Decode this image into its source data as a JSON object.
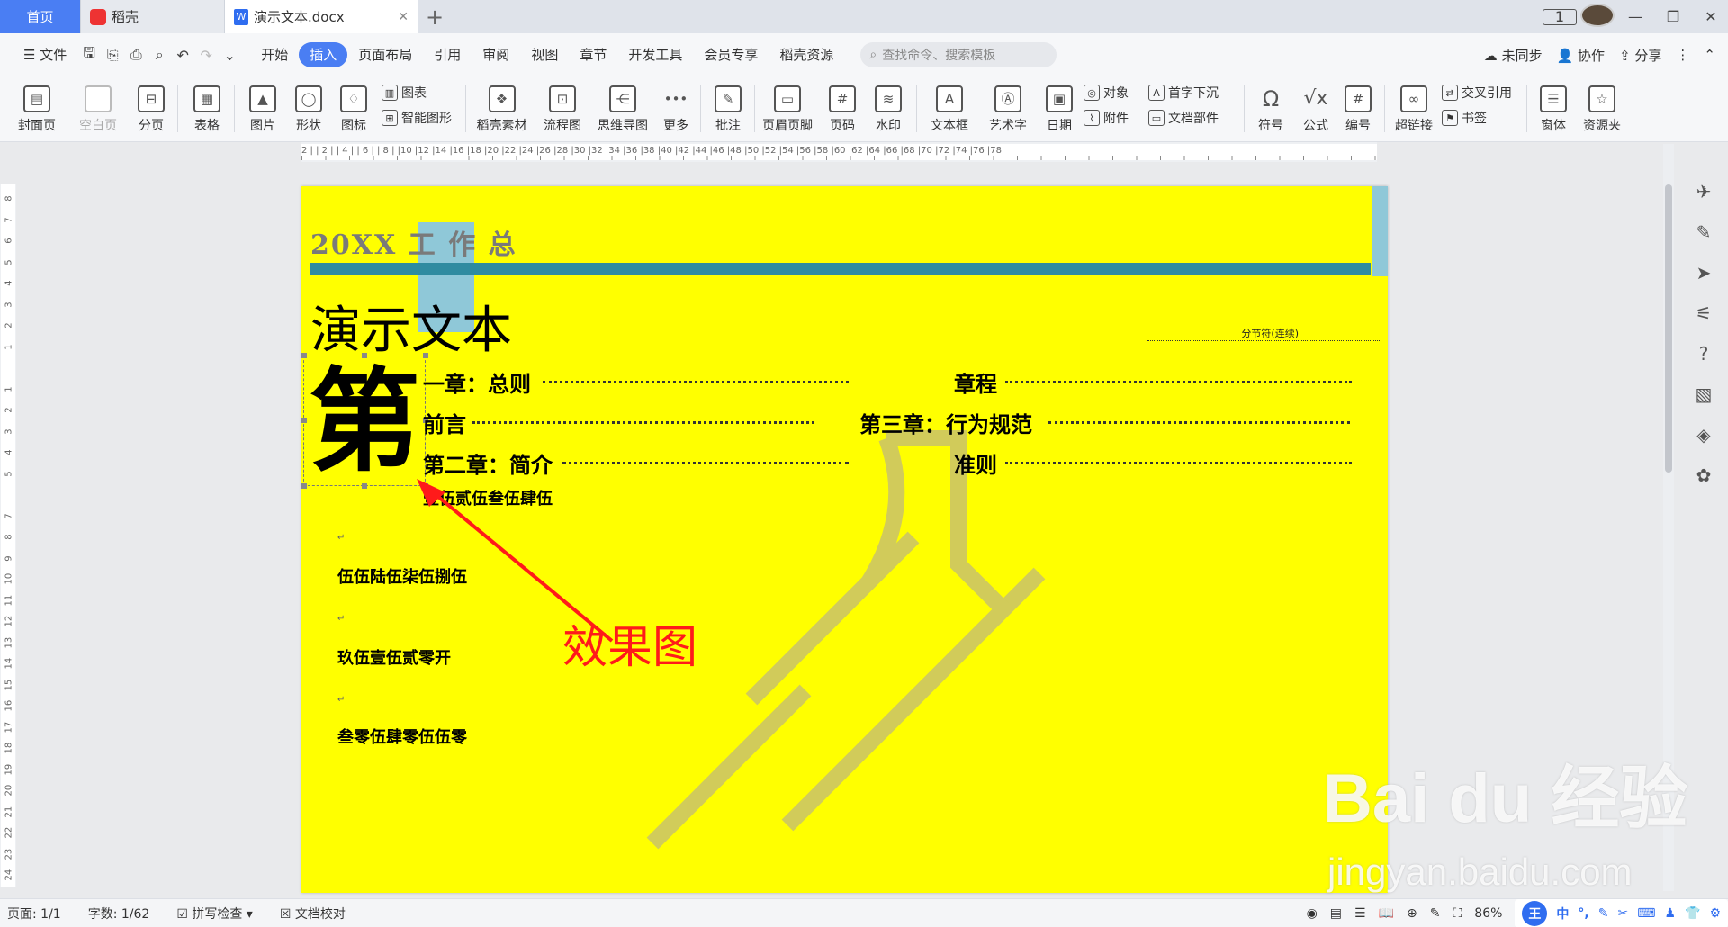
{
  "tabs": {
    "home": "首页",
    "daoke": "稻壳",
    "doc": "演示文本.docx"
  },
  "window": {
    "page_badge": "1"
  },
  "menu": {
    "file": "文件",
    "items": [
      "开始",
      "插入",
      "页面布局",
      "引用",
      "审阅",
      "视图",
      "章节",
      "开发工具",
      "会员专享",
      "稻壳资源"
    ],
    "active": "插入",
    "search_placeholder": "查找命令、搜索模板",
    "unsync": "未同步",
    "collab": "协作",
    "share": "分享"
  },
  "ribbon": {
    "cover": "封面页",
    "blank": "空白页",
    "pagebreak": "分页",
    "table": "表格",
    "picture": "图片",
    "shape": "形状",
    "icon": "图标",
    "chart": "图表",
    "smartart": "智能图形",
    "material": "稻壳素材",
    "flowchart": "流程图",
    "mindmap": "思维导图",
    "more": "更多",
    "comment": "批注",
    "headerfooter": "页眉页脚",
    "pagenum": "页码",
    "watermark": "水印",
    "textbox": "文本框",
    "wordart": "艺术字",
    "date": "日期",
    "object": "对象",
    "attachment": "附件",
    "dropcap": "首字下沉",
    "docparts": "文档部件",
    "symbol": "符号",
    "formula": "公式",
    "numbering": "编号",
    "hyperlink": "超链接",
    "crossref": "交叉引用",
    "bookmark": "书签",
    "form": "窗体",
    "resource": "资源夹"
  },
  "ruler": {
    "h_numbers": "2 | | 2 | | 4 | | 6 | | 8 | |10 |12 |14 |16 |18 |20 |22 |24 |26 |28 |30 |32 |34 |36 |38 |40 |42 |44 |46 |48 |50 |52 |54 |56 |58 |60 |62 |64 |66 |68 |70 |72 |74 |76 |78",
    "v_numbers": [
      "8",
      "7",
      "6",
      "5",
      "4",
      "3",
      "2",
      "1",
      "",
      "1",
      "2",
      "3",
      "4",
      "5",
      "",
      "7",
      "8",
      "9",
      "10",
      "11",
      "12",
      "13",
      "14",
      "15",
      "16",
      "17",
      "18",
      "19",
      "20",
      "21",
      "22",
      "23",
      "24"
    ]
  },
  "document": {
    "header_text": "20XX 工 作 总",
    "title": "演示文本",
    "section_break": "分节符(连续)",
    "dropcap": "第",
    "toc": {
      "ch1": "一章：总则",
      "preface": "前言",
      "ch2": "第二章：简介",
      "rules": "章程",
      "ch3": "第三章：行为规范",
      "norms": "准则"
    },
    "lines": [
      "壹伍贰伍叁伍肆伍",
      "伍伍陆伍柒伍捌伍",
      "玖伍壹伍贰零开",
      "叁零伍肆零伍伍零"
    ],
    "annotation": "效果图"
  },
  "status": {
    "page": "页面: 1/1",
    "words": "字数: 1/62",
    "spell": "拼写检查",
    "proof": "文档校对",
    "zoom": "86%"
  },
  "ime": {
    "logo": "王",
    "lang": "中"
  },
  "watermark": {
    "brand": "Bai du 经验",
    "url": "jingyan.baidu.com"
  }
}
